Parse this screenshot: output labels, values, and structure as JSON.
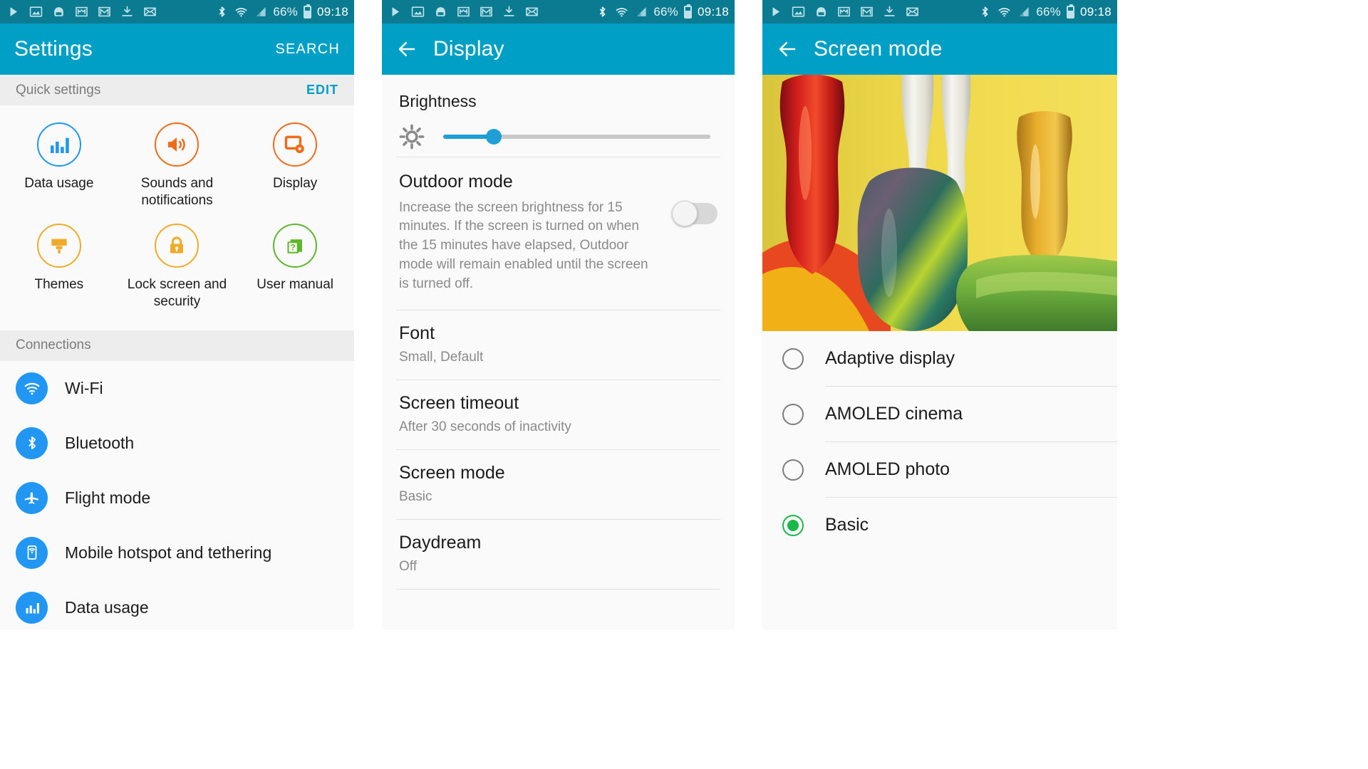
{
  "statusbar": {
    "icons": [
      "play-icon",
      "image-icon",
      "galaxy-apps-icon",
      "gmail-icon",
      "gmail-icon-2",
      "download-icon",
      "email-icon"
    ],
    "bluetooth": "bluetooth-icon",
    "wifi": "wifi-icon",
    "signal": "cell-signal-icon",
    "battery_percent": "66%",
    "time": "09:18"
  },
  "panel1": {
    "title": "Settings",
    "search_label": "SEARCH",
    "quick_settings": {
      "header": "Quick settings",
      "edit_label": "EDIT",
      "items": [
        {
          "label": "Data usage",
          "icon": "data-usage-icon",
          "color": "#2196f3"
        },
        {
          "label": "Sounds and notifications",
          "icon": "volume-icon",
          "color": "#ef6c1a"
        },
        {
          "label": "Display",
          "icon": "display-icon",
          "color": "#ef6c1a"
        },
        {
          "label": "Themes",
          "icon": "paintbrush-icon",
          "color": "#f0ab29"
        },
        {
          "label": "Lock screen and security",
          "icon": "lock-icon",
          "color": "#f0ab29"
        },
        {
          "label": "User manual",
          "icon": "manual-icon",
          "color": "#5cb82b"
        }
      ]
    },
    "connections": {
      "header": "Connections",
      "items": [
        {
          "label": "Wi-Fi",
          "icon": "wifi-icon"
        },
        {
          "label": "Bluetooth",
          "icon": "bluetooth-icon"
        },
        {
          "label": "Flight mode",
          "icon": "airplane-icon"
        },
        {
          "label": "Mobile hotspot and tethering",
          "icon": "hotspot-icon"
        },
        {
          "label": "Data usage",
          "icon": "data-usage-icon"
        }
      ]
    }
  },
  "panel2": {
    "title": "Display",
    "back_icon": "back-arrow-icon",
    "brightness": {
      "label": "Brightness",
      "icon": "brightness-sun-icon",
      "value_percent": 19
    },
    "outdoor_mode": {
      "title": "Outdoor mode",
      "description": "Increase the screen brightness for 15 minutes. If the screen is turned on when the 15 minutes have elapsed, Outdoor mode will remain enabled until the screen is turned off.",
      "toggle_state": "off"
    },
    "rows": [
      {
        "title": "Font",
        "subtitle": "Small, Default"
      },
      {
        "title": "Screen timeout",
        "subtitle": "After 30 seconds of inactivity"
      },
      {
        "title": "Screen mode",
        "subtitle": "Basic"
      },
      {
        "title": "Daydream",
        "subtitle": "Off"
      }
    ]
  },
  "panel3": {
    "title": "Screen mode",
    "back_icon": "back-arrow-icon",
    "preview_alt": "colorful-glass-vases-preview",
    "options": [
      {
        "label": "Adaptive display",
        "selected": false
      },
      {
        "label": "AMOLED cinema",
        "selected": false
      },
      {
        "label": "AMOLED photo",
        "selected": false
      },
      {
        "label": "Basic",
        "selected": true
      }
    ]
  },
  "colors": {
    "status_bar": "#0b7b92",
    "action_bar": "#00a0c6",
    "accent": "#00a0c6",
    "slider": "#1f9fd6",
    "radio_selected": "#18b84a",
    "section_bg": "#ededed"
  }
}
